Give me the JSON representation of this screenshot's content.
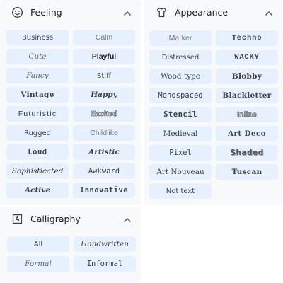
{
  "feeling": {
    "title": "Feeling",
    "icon": "smiley-icon",
    "items": [
      {
        "label": "Business",
        "style": "f-plain"
      },
      {
        "label": "Calm",
        "style": "f-light"
      },
      {
        "label": "Cute",
        "style": "f-script"
      },
      {
        "label": "Playful",
        "style": "f-bold"
      },
      {
        "label": "Fancy",
        "style": "f-script"
      },
      {
        "label": "Stiff",
        "style": "f-plain"
      },
      {
        "label": "Vintage",
        "style": "f-blackletter"
      },
      {
        "label": "Happy",
        "style": "f-italic-bold"
      },
      {
        "label": "Futuristic",
        "style": "f-wide"
      },
      {
        "label": "Excited",
        "style": "f-outline"
      },
      {
        "label": "Rugged",
        "style": "f-plain"
      },
      {
        "label": "Childlike",
        "style": "f-light"
      },
      {
        "label": "Loud",
        "style": "f-mono-bold"
      },
      {
        "label": "Artistic",
        "style": "f-italic-bold"
      },
      {
        "label": "Sophisticated",
        "style": "f-italic-serif"
      },
      {
        "label": "Awkward",
        "style": "f-mono"
      },
      {
        "label": "Active",
        "style": "f-italic-bold"
      },
      {
        "label": "Innovative",
        "style": "f-mono-bold"
      }
    ]
  },
  "appearance": {
    "title": "Appearance",
    "icon": "shirt-icon",
    "items": [
      {
        "label": "Marker",
        "style": "f-light"
      },
      {
        "label": "Techno",
        "style": "f-caps"
      },
      {
        "label": "Distressed",
        "style": "f-plain"
      },
      {
        "label": "WACKY",
        "style": "f-caps"
      },
      {
        "label": "Wood type",
        "style": "f-serif"
      },
      {
        "label": "Blobby",
        "style": "f-blackletter"
      },
      {
        "label": "Monospaced",
        "style": "f-mono"
      },
      {
        "label": "Blackletter",
        "style": "f-blackletter"
      },
      {
        "label": "Stencil",
        "style": "f-mono-bold"
      },
      {
        "label": "Inline",
        "style": "f-outline"
      },
      {
        "label": "Medieval",
        "style": "f-serif"
      },
      {
        "label": "Art Deco",
        "style": "f-blackletter"
      },
      {
        "label": "Pixel",
        "style": "f-mono"
      },
      {
        "label": "Shaded",
        "style": "f-shaded"
      },
      {
        "label": "Art Nouveau",
        "style": "f-serif"
      },
      {
        "label": "Tuscan",
        "style": "f-blackletter"
      },
      {
        "label": "Not text",
        "style": "f-plain"
      }
    ]
  },
  "calligraphy": {
    "title": "Calligraphy",
    "icon": "calligraphy-icon",
    "items": [
      {
        "label": "All",
        "style": "f-plain"
      },
      {
        "label": "Handwritten",
        "style": "f-italic-serif"
      },
      {
        "label": "Formal",
        "style": "f-script"
      },
      {
        "label": "Informal",
        "style": "f-mono"
      }
    ]
  },
  "colors": {
    "panel_bg": "#f8f9fa",
    "chip_bg": "#e7f0fe",
    "text": "#202124"
  }
}
